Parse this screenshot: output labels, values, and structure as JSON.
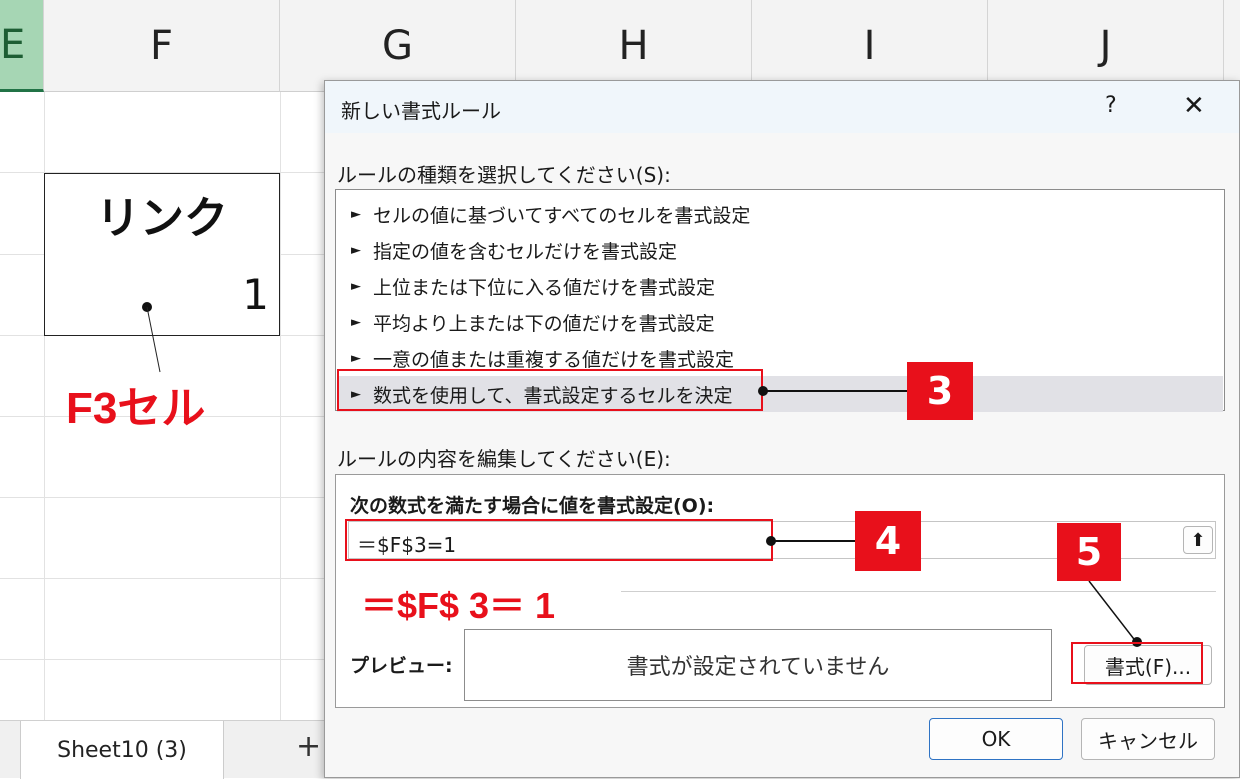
{
  "columns": [
    "E",
    "F",
    "G",
    "H",
    "I",
    "J"
  ],
  "cells": {
    "header": "リンク",
    "value": "1"
  },
  "annotations": {
    "cell_label": "F3セル",
    "formula_label": "＝$F$ 3＝ 1",
    "step3": "3",
    "step4": "4",
    "step5": "5"
  },
  "sheet_tabs": {
    "active": "Sheet10 (3)",
    "add": "+"
  },
  "dialog": {
    "title": "新しい書式ルール",
    "help": "?",
    "close": "✕",
    "rule_type_label": "ルールの種類を選択してください(S):",
    "rules": [
      "セルの値に基づいてすべてのセルを書式設定",
      "指定の値を含むセルだけを書式設定",
      "上位または下位に入る値だけを書式設定",
      "平均より上または下の値だけを書式設定",
      "一意の値または重複する値だけを書式設定",
      "数式を使用して、書式設定するセルを決定"
    ],
    "selected_rule_index": 5,
    "edit_label": "ルールの内容を編集してください(E):",
    "formula_label": "次の数式を満たす場合に値を書式設定(O):",
    "formula_value": "＝$F$3=1",
    "preview_label": "プレビュー:",
    "preview_text": "書式が設定されていません",
    "format_button": "書式(F)...",
    "ok_button": "OK",
    "cancel_button": "キャンセル"
  }
}
